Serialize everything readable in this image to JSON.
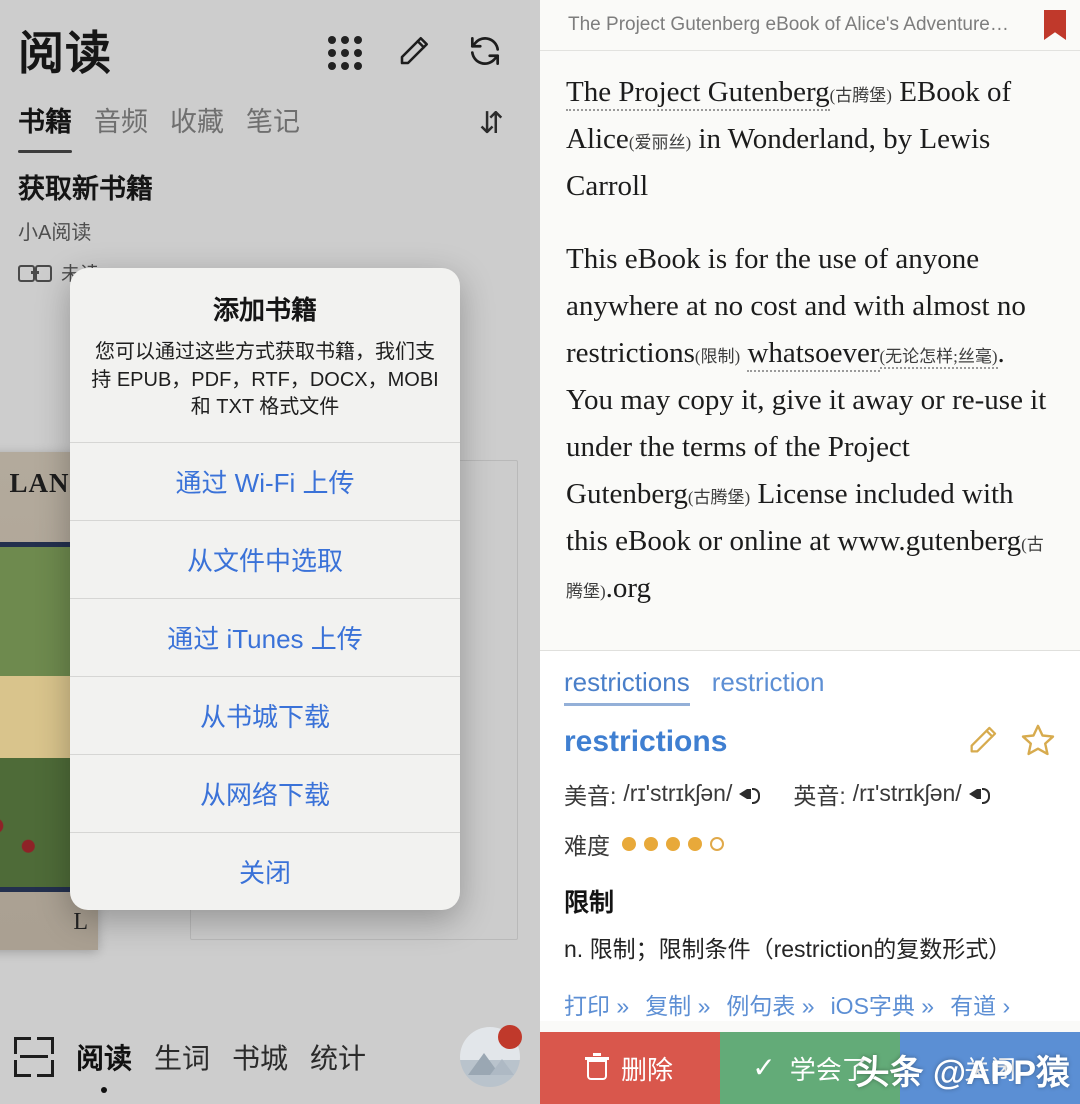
{
  "left": {
    "app_title": "阅读",
    "header_icons": [
      {
        "name": "grid-icon",
        "label": "grid"
      },
      {
        "name": "edit-icon",
        "label": "✎"
      },
      {
        "name": "refresh-icon",
        "label": "⟳"
      }
    ],
    "tabs": [
      {
        "label": "书籍",
        "active": true
      },
      {
        "label": "音频",
        "active": false
      },
      {
        "label": "收藏",
        "active": false
      },
      {
        "label": "笔记",
        "active": false
      }
    ],
    "sort_icon": "⇵",
    "section": {
      "title": "获取新书籍",
      "subtitle": "小A阅读",
      "meta": "未读"
    },
    "book": {
      "cover_title": "LAND",
      "cover_footer": "L"
    },
    "bottom_nav": {
      "scan_icon": "scan-icon",
      "items": [
        {
          "label": "阅读",
          "active": true
        },
        {
          "label": "生词",
          "active": false
        },
        {
          "label": "书城",
          "active": false
        },
        {
          "label": "统计",
          "active": false
        }
      ]
    }
  },
  "dialog": {
    "title": "添加书籍",
    "message": "您可以通过这些方式获取书籍，我们支持 EPUB，PDF，RTF，DOCX，MOBI 和 TXT 格式文件",
    "buttons": [
      {
        "label": "通过 Wi-Fi 上传",
        "name": "upload-via-wifi-button"
      },
      {
        "label": "从文件中选取",
        "name": "pick-from-files-button"
      },
      {
        "label": "通过 iTunes 上传",
        "name": "upload-via-itunes-button"
      },
      {
        "label": "从书城下载",
        "name": "download-from-store-button"
      },
      {
        "label": "从网络下载",
        "name": "download-from-web-button"
      },
      {
        "label": "关闭",
        "name": "close-dialog-button"
      }
    ]
  },
  "right": {
    "doc_title": "The Project Gutenberg eBook of Alice's Adventure…",
    "reader": {
      "p1_a": "The Project Gutenberg",
      "p1_g1": "(古腾堡)",
      "p1_b": "EBook of Alice",
      "p1_g2": "(爱丽丝)",
      "p1_c": "in Wonderland, by Lewis Carroll",
      "p2_a": "This eBook is for the use of anyone anywhere at no cost and with almost no restrictions",
      "p2_g1": "(限制)",
      "p2_b": "whatsoever",
      "p2_g2": "(无论怎样;丝毫)",
      "p2_c": ". You may copy it, give it away or re-use it under the terms of the Project Gutenberg",
      "p2_g3": "(古腾堡)",
      "p2_d": "License included with this eBook or online at www.gutenberg",
      "p2_g4": "(古腾堡)",
      "p2_e": ".org"
    },
    "dict": {
      "tabs": [
        {
          "label": "restrictions",
          "active": true
        },
        {
          "label": "restriction",
          "active": false
        }
      ],
      "word": "restrictions",
      "edit_icon": "pencil-icon",
      "star_icon": "star-icon",
      "phonetics": [
        {
          "label": "美音:",
          "value": "/rɪ'strɪkʃən/"
        },
        {
          "label": "英音:",
          "value": "/rɪ'strɪkʃən/"
        }
      ],
      "difficulty_label": "难度",
      "difficulty_filled": 4,
      "difficulty_total": 5,
      "meaning_zh": "限制",
      "definition": "n. 限制；限制条件（restriction的复数形式）",
      "links": [
        "打印 »",
        "复制 »",
        "例句表 »",
        "iOS字典 »",
        "有道 ›"
      ]
    },
    "actions": [
      {
        "label": "删除",
        "name": "delete-button",
        "color": "#d9574c"
      },
      {
        "label": "学会了",
        "name": "learned-button",
        "color": "#63ab78"
      },
      {
        "label": "关闭",
        "name": "close-button",
        "color": "#5b8fd4"
      }
    ]
  },
  "watermark": "头条 @APP猿"
}
